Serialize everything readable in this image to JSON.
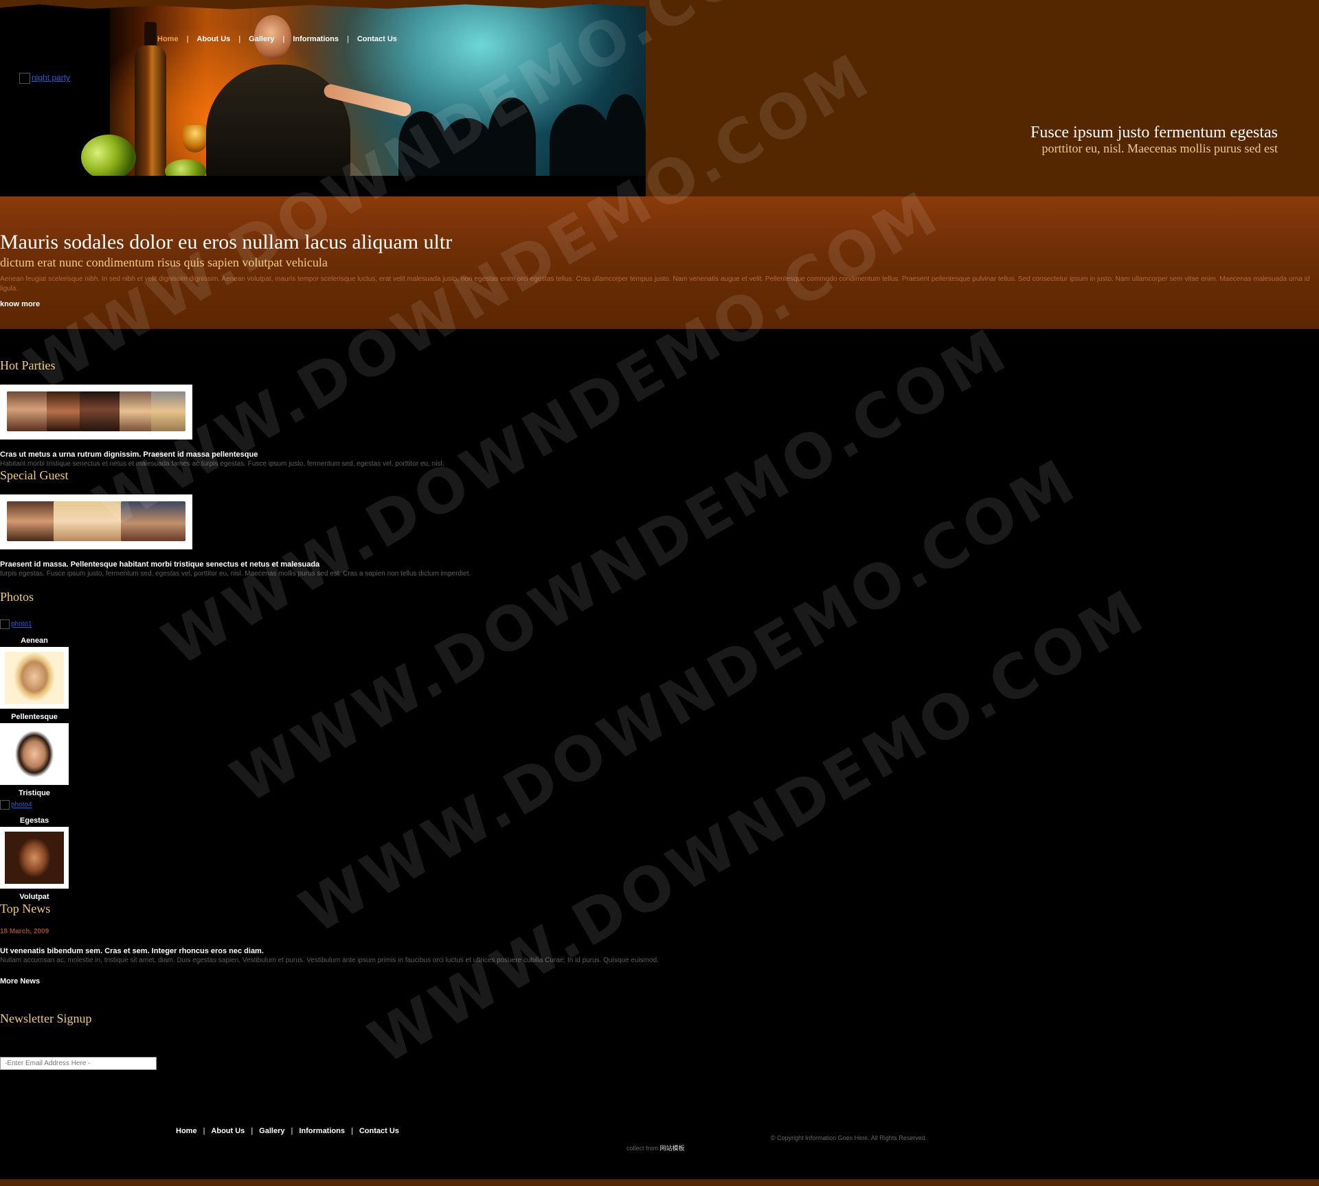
{
  "header": {
    "logo_alt": "night party",
    "nav": [
      "Home",
      "About Us",
      "Gallery",
      "Informations",
      "Contact Us"
    ],
    "tagline_title": "Fusce ipsum justo fermentum egestas",
    "tagline_sub": "porttitor eu, nisl. Maecenas mollis purus sed est"
  },
  "banner": {
    "title": "Mauris sodales dolor eu eros nullam lacus aliquam ultr",
    "subtitle": "dictum erat nunc condimentum risus quis sapien volutpat vehicula",
    "body": "Aenean feugiat scelerisque nibh. In sed nibh et velit dignissim dignissim. Aenean volutpat, mauris tempor scelerisque luctus, erat velit malesuada justo, non egestas enim orci egestas tellus. Cras ullamcorper tempus justo. Nam venenatis augue et velit. Pellentesque commodo condimentum tellus. Praesent pellentesque pulvinar tellus. Sed consectetur ipsum in justo. Nam ullamcorper sem vitae enim. Maecenas malesuada urna id ligula.",
    "more": "know more"
  },
  "hot_parties": {
    "title": "Hot Parties",
    "headline": "Cras ut metus a urna rutrum dignissim. Praesent id massa pellentesque",
    "text": "Habitant morbi tristique senectus et netus et malesuada fames ac turpis egestas. Fusce ipsum justo, fermentum sed, egestas vel, porttitor eu, nisl."
  },
  "special_guest": {
    "title": "Special Guest",
    "headline": "Praesent id massa. Pellentesque habitant morbi tristique senectus et netus et malesuada",
    "text": "turpis egestas. Fusce ipsum justo, fermentum sed, egestas vel, porttitor eu, nisl. Maecenas mollis purus sed est. Cras a sapien non tellus dictum imperdiet."
  },
  "photos": {
    "title": "Photos",
    "broken_alt_1": "photo1",
    "broken_alt_2": "photo4",
    "captions": [
      "Aenean",
      "Pellentesque",
      "Tristique",
      "Egestas",
      "Volutpat"
    ]
  },
  "top_news": {
    "title": "Top News",
    "date": "18 March, 2009",
    "headline": "Ut venenatis bibendum sem. Cras et sem. Integer rhoncus eros nec diam.",
    "text": "Nullam accumsan ac, molestie in, tristique sit amet, diam. Duis egestas sapien. Vestibulum et purus. Vestibulum ante ipsum primis in faucibus orci luctus et ultrices posuere cubilia Curae; In id purus. Quisque euismod.",
    "more": "More News"
  },
  "newsletter": {
    "title": "Newsletter Signup",
    "placeholder": "-Enter Email Address Here -"
  },
  "footer": {
    "nav": [
      "Home",
      "About Us",
      "Gallery",
      "Informations",
      "Contact Us"
    ],
    "copyright": "© Copyright Information Goes Here. All Rights Reserved.",
    "collect_prefix": "collect from",
    "collect_link": "网站模板"
  },
  "watermark": "WWW.DOWNDEMO.COM",
  "colors": {
    "header_bg": "#552700",
    "banner_top": "#8b3a0a",
    "heading_gold": "#f2cc7e",
    "nav_active": "#f3a43c",
    "body_bg": "#000000"
  }
}
